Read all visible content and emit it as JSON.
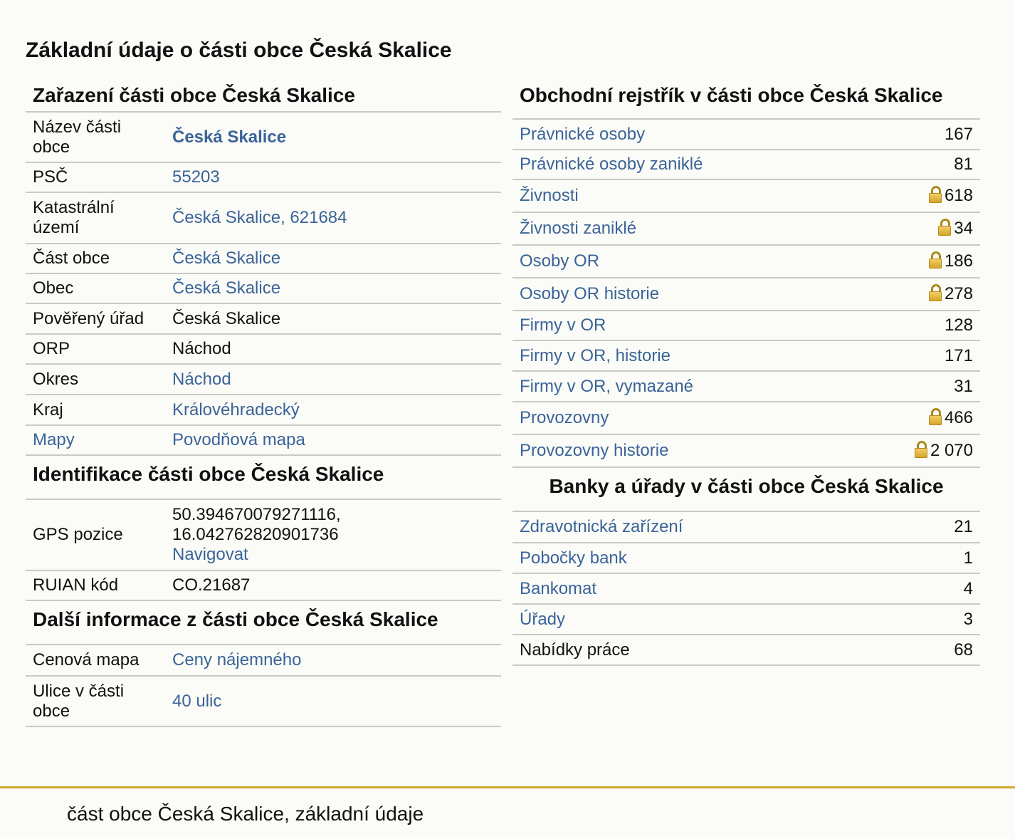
{
  "page_title": "Základní údaje o části obce Česká Skalice",
  "zarazeni": {
    "title": "Zařazení části obce Česká Skalice",
    "rows": [
      {
        "label": "Název části obce",
        "value": "Česká Skalice",
        "link": true,
        "bold": true
      },
      {
        "label": "PSČ",
        "value": "55203",
        "link": true
      },
      {
        "label": "Katastrální území",
        "value": "Česká Skalice, 621684",
        "link": true
      },
      {
        "label": "Část obce",
        "value": "Česká Skalice",
        "link": true
      },
      {
        "label": "Obec",
        "value": "Česká Skalice",
        "link": true
      },
      {
        "label": "Pověřený úřad",
        "value": "Česká Skalice",
        "link": false
      },
      {
        "label": "ORP",
        "value": "Náchod",
        "link": false
      },
      {
        "label": "Okres",
        "value": "Náchod",
        "link": true
      },
      {
        "label": "Kraj",
        "value": "Královéhradecký",
        "link": true
      },
      {
        "label": "Mapy",
        "label_link": true,
        "value": "Povodňová mapa",
        "link": true
      }
    ]
  },
  "identifikace": {
    "title": "Identifikace části obce Česká Skalice",
    "gps_label": "GPS pozice",
    "gps_lat": "50.394670079271116,",
    "gps_lon": "16.042762820901736",
    "navigate_label": "Navigovat",
    "ruian_label": "RUIAN kód",
    "ruian_value": "CO.21687"
  },
  "dalsi": {
    "title": "Další informace z části obce Česká Skalice",
    "rows": [
      {
        "label": "Cenová mapa",
        "value": "Ceny nájemného"
      },
      {
        "label": "Ulice v části obce",
        "value": "40 ulic"
      }
    ]
  },
  "obchodni": {
    "title": "Obchodní rejstřík v části obce Česká Skalice",
    "rows": [
      {
        "label": "Právnické osoby",
        "value": "167",
        "lock": false
      },
      {
        "label": "Právnické osoby zaniklé",
        "value": "81",
        "lock": false
      },
      {
        "label": "Živnosti",
        "value": "618",
        "lock": true
      },
      {
        "label": "Živnosti zaniklé",
        "value": "34",
        "lock": true
      },
      {
        "label": "Osoby OR",
        "value": "186",
        "lock": true
      },
      {
        "label": "Osoby OR historie",
        "value": "278",
        "lock": true
      },
      {
        "label": "Firmy v OR",
        "value": "128",
        "lock": false
      },
      {
        "label": "Firmy v OR, historie",
        "value": "171",
        "lock": false
      },
      {
        "label": "Firmy v OR, vymazané",
        "value": "31",
        "lock": false
      },
      {
        "label": "Provozovny",
        "value": "466",
        "lock": true
      },
      {
        "label": "Provozovny historie",
        "value": "2 070",
        "lock": true
      }
    ]
  },
  "banky": {
    "title": "Banky a úřady v části obce Česká Skalice",
    "rows": [
      {
        "label": "Zdravotnická zařízení",
        "value": "21",
        "link": true
      },
      {
        "label": "Pobočky bank",
        "value": "1",
        "link": true
      },
      {
        "label": "Bankomat",
        "value": "4",
        "link": true
      },
      {
        "label": "Úřady",
        "value": "3",
        "link": true
      },
      {
        "label": "Nabídky práce",
        "value": "68",
        "link": false
      }
    ]
  },
  "footer": {
    "text": "část obce Česká Skalice, základní údaje"
  },
  "colors": {
    "link": "#3a6499",
    "divider": "#c9c9c9",
    "footer_line": "#d4a82f",
    "background": "#fbfbf7"
  }
}
